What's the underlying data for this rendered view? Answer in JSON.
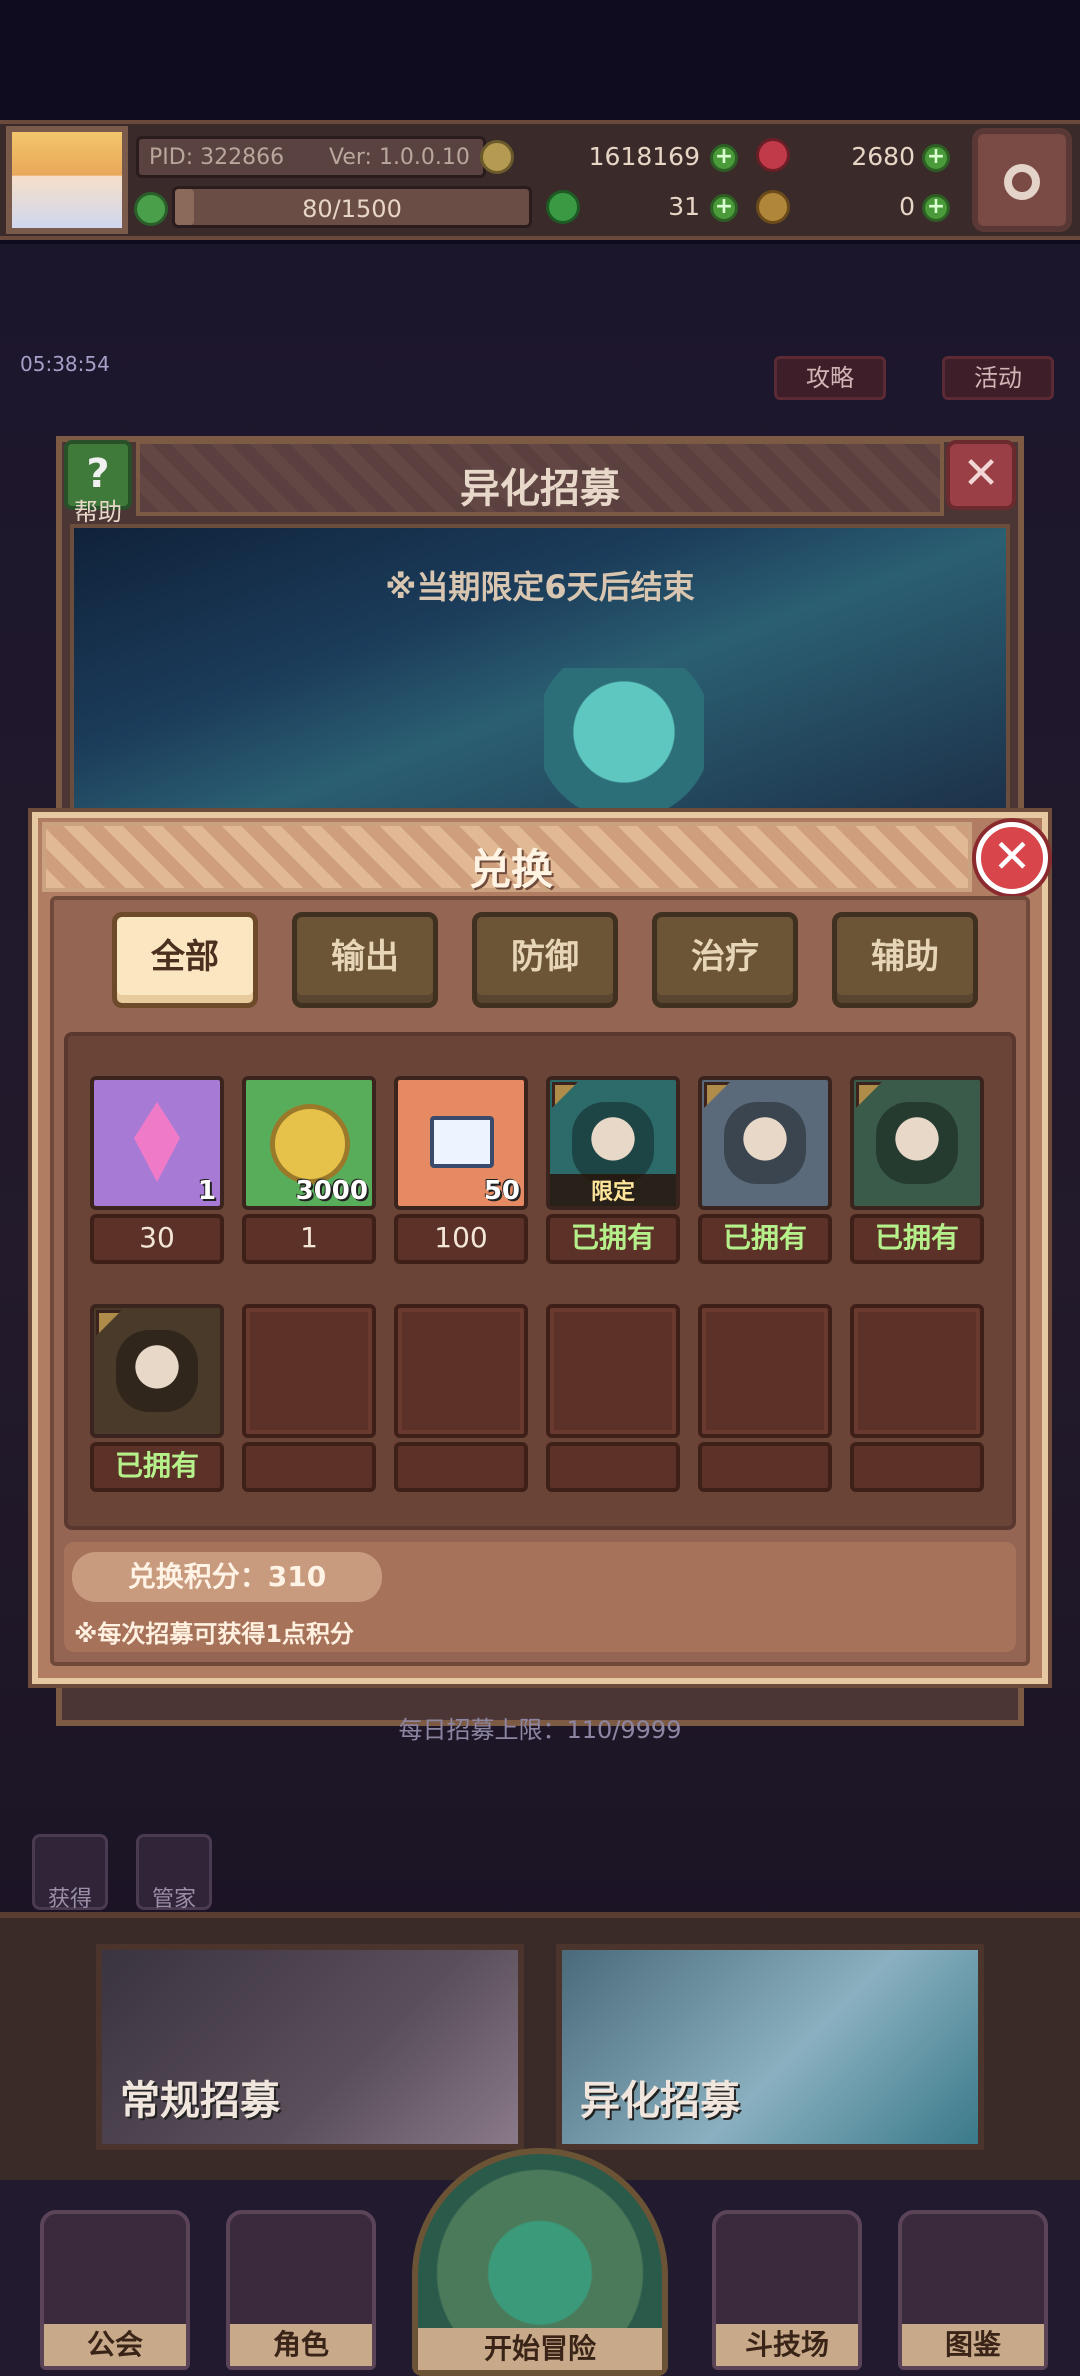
{
  "status_bar": {
    "pid": "PID: 322866",
    "version": "Ver: 1.0.0.10",
    "gold": "1618169",
    "gems": "2680",
    "stamina": "80/1500",
    "stamina_progress": 0.053,
    "clover": "31",
    "keys": "0"
  },
  "background": {
    "timer": "05:38:54",
    "side_buttons": [
      "攻略",
      "活动"
    ],
    "panel_title": "异化招募",
    "help_label": "帮助",
    "banner_note": "※当期限定6天后结束",
    "daily_limit": "每日招募上限：110/9999",
    "mini_buttons": [
      "获得",
      "管家"
    ]
  },
  "modal": {
    "title": "兑换",
    "tabs": [
      "全部",
      "输出",
      "防御",
      "治疗",
      "辅助"
    ],
    "active_tab": "全部",
    "items": [
      {
        "kind": "crystal",
        "qty": "1",
        "label": "30",
        "owned": false,
        "color": "#a77ad6"
      },
      {
        "kind": "coin",
        "qty": "3000",
        "label": "1",
        "owned": false,
        "color": "#58ad5a"
      },
      {
        "kind": "ticket",
        "qty": "50",
        "label": "100",
        "owned": false,
        "color": "#e58a62"
      },
      {
        "kind": "character",
        "tag": "限定",
        "label": "已拥有",
        "owned": true,
        "color": "#2d6a6a"
      },
      {
        "kind": "character",
        "label": "已拥有",
        "owned": true,
        "color": "#5a6a7a"
      },
      {
        "kind": "character",
        "label": "已拥有",
        "owned": true,
        "color": "#3a5a4a"
      },
      {
        "kind": "character",
        "label": "已拥有",
        "owned": true,
        "color": "#4a3a2a"
      }
    ],
    "points_label": "兑换积分：310",
    "points_note": "※每次招募可获得1点积分"
  },
  "recruit": {
    "normal": "常规招募",
    "special": "异化招募"
  },
  "nav": [
    "公会",
    "角色",
    "开始冒险",
    "斗技场",
    "图鉴"
  ]
}
